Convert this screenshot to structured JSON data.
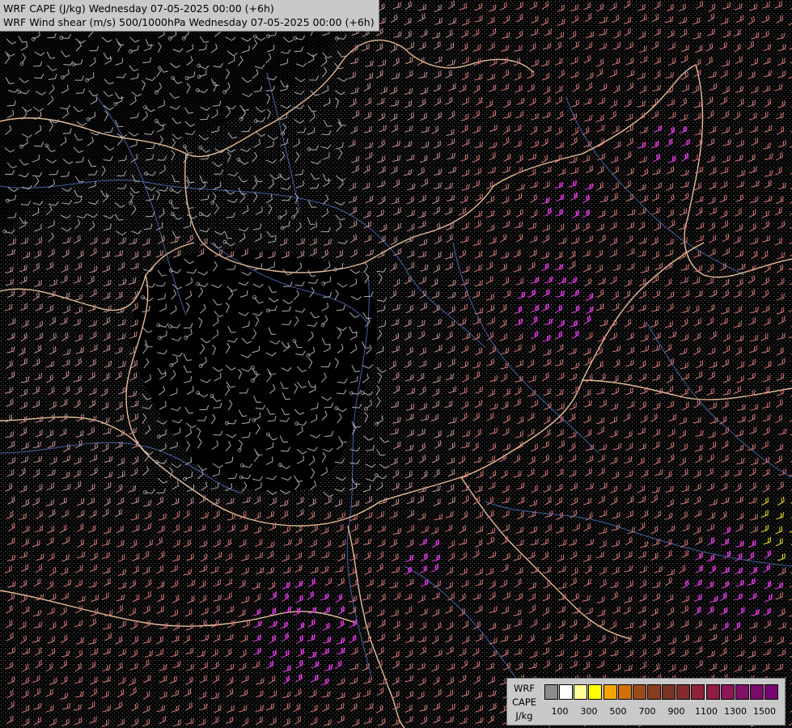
{
  "title": {
    "line1": "WRF CAPE (J/kg) Wednesday 07-05-2025 00:00 (+6h)",
    "line2": "WRF Wind shear (m/s) 500/1000hPa Wednesday 07-05-2025 00:00 (+6h)"
  },
  "legend": {
    "label_top": "WRF",
    "label_mid": "CAPE",
    "label_unit": "J/kg",
    "ticks": [
      "100",
      "300",
      "500",
      "700",
      "900",
      "1100",
      "1300",
      "1500"
    ],
    "colors": [
      "#8c8c8c",
      "#ffffff",
      "#ffff99",
      "#ffff00",
      "#f6a300",
      "#d27100",
      "#9b4a1a",
      "#873e1f",
      "#7a3423",
      "#852a2a",
      "#8e2238",
      "#911d47",
      "#8a1757",
      "#811165",
      "#7b0a6a",
      "#760472"
    ]
  },
  "colors": {
    "background": "#000000",
    "borders": "#f3c8a0",
    "rivers": "#4c6fb4",
    "barb_low": "#b0b0b0",
    "barb_mid": "#c79292",
    "barb_high": "#d87a7a",
    "barb_max": "#e63ce6",
    "barb_extreme": "#f2f22a",
    "cape_dots": "#7a7a7a"
  },
  "map_features": [
    "country-borders",
    "rivers",
    "wind-barbs",
    "cape-stipple"
  ]
}
